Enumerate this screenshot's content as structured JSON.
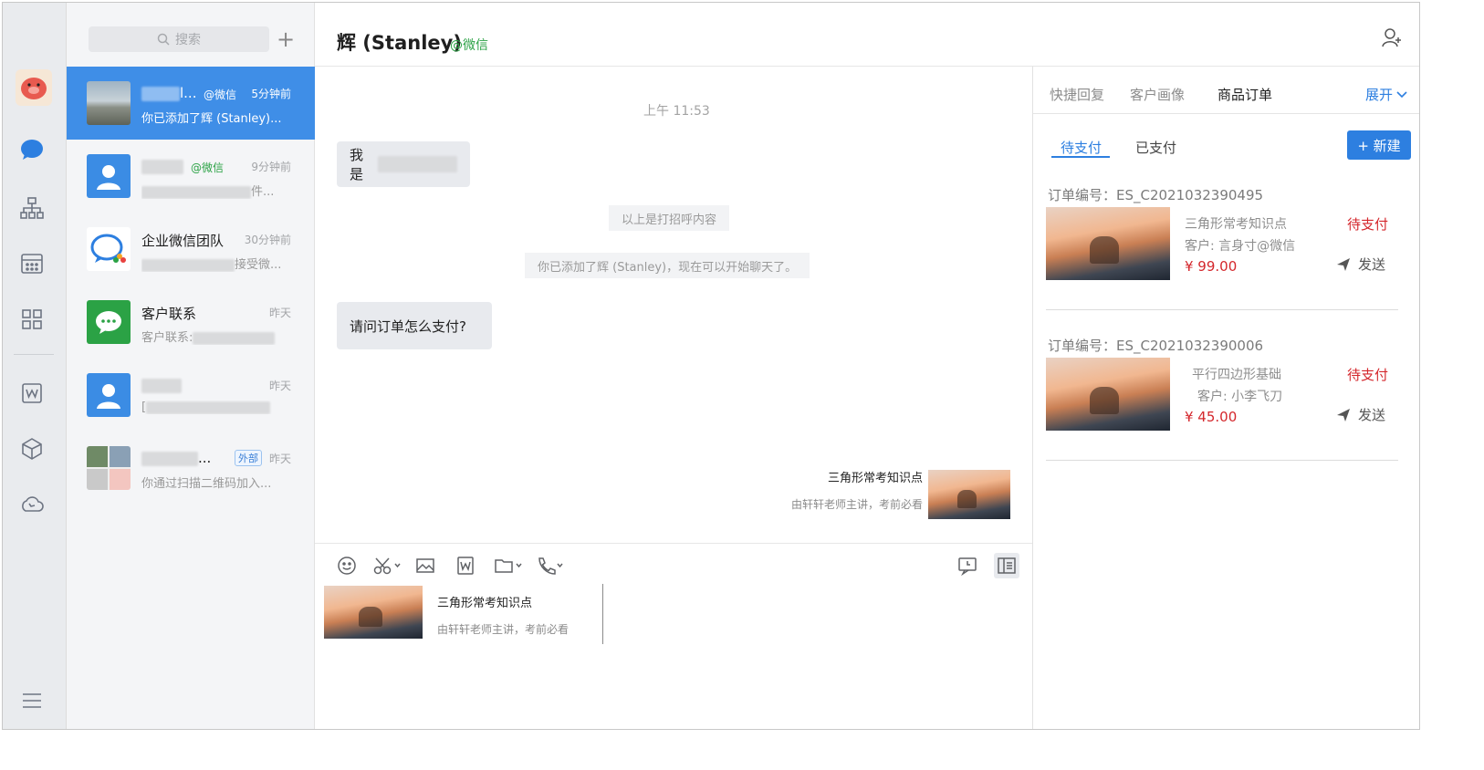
{
  "window": {
    "traffic_lights": [
      "close",
      "minimize",
      "zoom"
    ]
  },
  "rail": {
    "icons": [
      "avatar",
      "chat-bubble-icon",
      "org-chart-icon",
      "calendar-icon",
      "apps-grid-icon",
      "word-doc-icon",
      "cube-icon",
      "cloud-call-icon",
      "menu-icon"
    ],
    "active_color": "#2d7fe0"
  },
  "chat_list": {
    "search_placeholder": "搜索",
    "add_label": "+",
    "items": [
      {
        "name_suffix": "l...",
        "tag": "@微信",
        "time": "5分钟前",
        "preview": "你已添加了辉 (Stanley)...",
        "active": true
      },
      {
        "name_suffix": "",
        "tag": "@微信",
        "time": "9分钟前",
        "preview_end": "件...",
        "active": false
      },
      {
        "name": "企业微信团队",
        "time": "30分钟前",
        "preview_end": "接受微...",
        "active": false
      },
      {
        "name": "客户联系",
        "time": "昨天",
        "preview": "客户联系:",
        "active": false
      },
      {
        "name": "",
        "time": "昨天",
        "preview_start": "[",
        "active": false
      },
      {
        "name_suffix": "...",
        "badge": "外部",
        "time": "昨天",
        "preview": "你通过扫描二维码加入...",
        "active": false
      }
    ]
  },
  "chat": {
    "title": "辉 (Stanley)",
    "title_tag": "@微信",
    "time": "上午 11:53",
    "msg_intro": "我是",
    "sys_greeting": "以上是打招呼内容",
    "sys_added": "你已添加了辉 (Stanley)，现在可以开始聊天了。",
    "msg_question": "请问订单怎么支付?",
    "card": {
      "title": "三角形常考知识点",
      "subtitle": "由轩轩老师主讲，考前必看"
    }
  },
  "input": {
    "tools": [
      "emoji-icon",
      "scissors-icon",
      "image-icon",
      "word-doc-icon",
      "folder-icon",
      "phone-icon"
    ],
    "right_tools": [
      "screen-chat-icon",
      "sidebar-panel-icon"
    ],
    "draft": {
      "title": "三角形常考知识点",
      "subtitle": "由轩轩老师主讲，考前必看"
    }
  },
  "panel": {
    "tabs": [
      "快捷回复",
      "客户画像",
      "商品订单"
    ],
    "active_tab": 2,
    "expand": "展开",
    "sub_tabs": [
      "待支付",
      "已支付"
    ],
    "new_button": "+ 新建",
    "orders": [
      {
        "order_no": "订单编号：ES_C2021032390495",
        "name": "三角形常考知识点",
        "customer": "客户: 言身寸@微信",
        "price": "¥ 99.00",
        "status": "待支付",
        "send": "发送"
      },
      {
        "order_no": "订单编号：ES_C2021032390006",
        "name": "平行四边形基础",
        "customer": "客户: 小李飞刀",
        "price": "¥ 45.00",
        "status": "待支付",
        "send": "发送"
      }
    ]
  }
}
